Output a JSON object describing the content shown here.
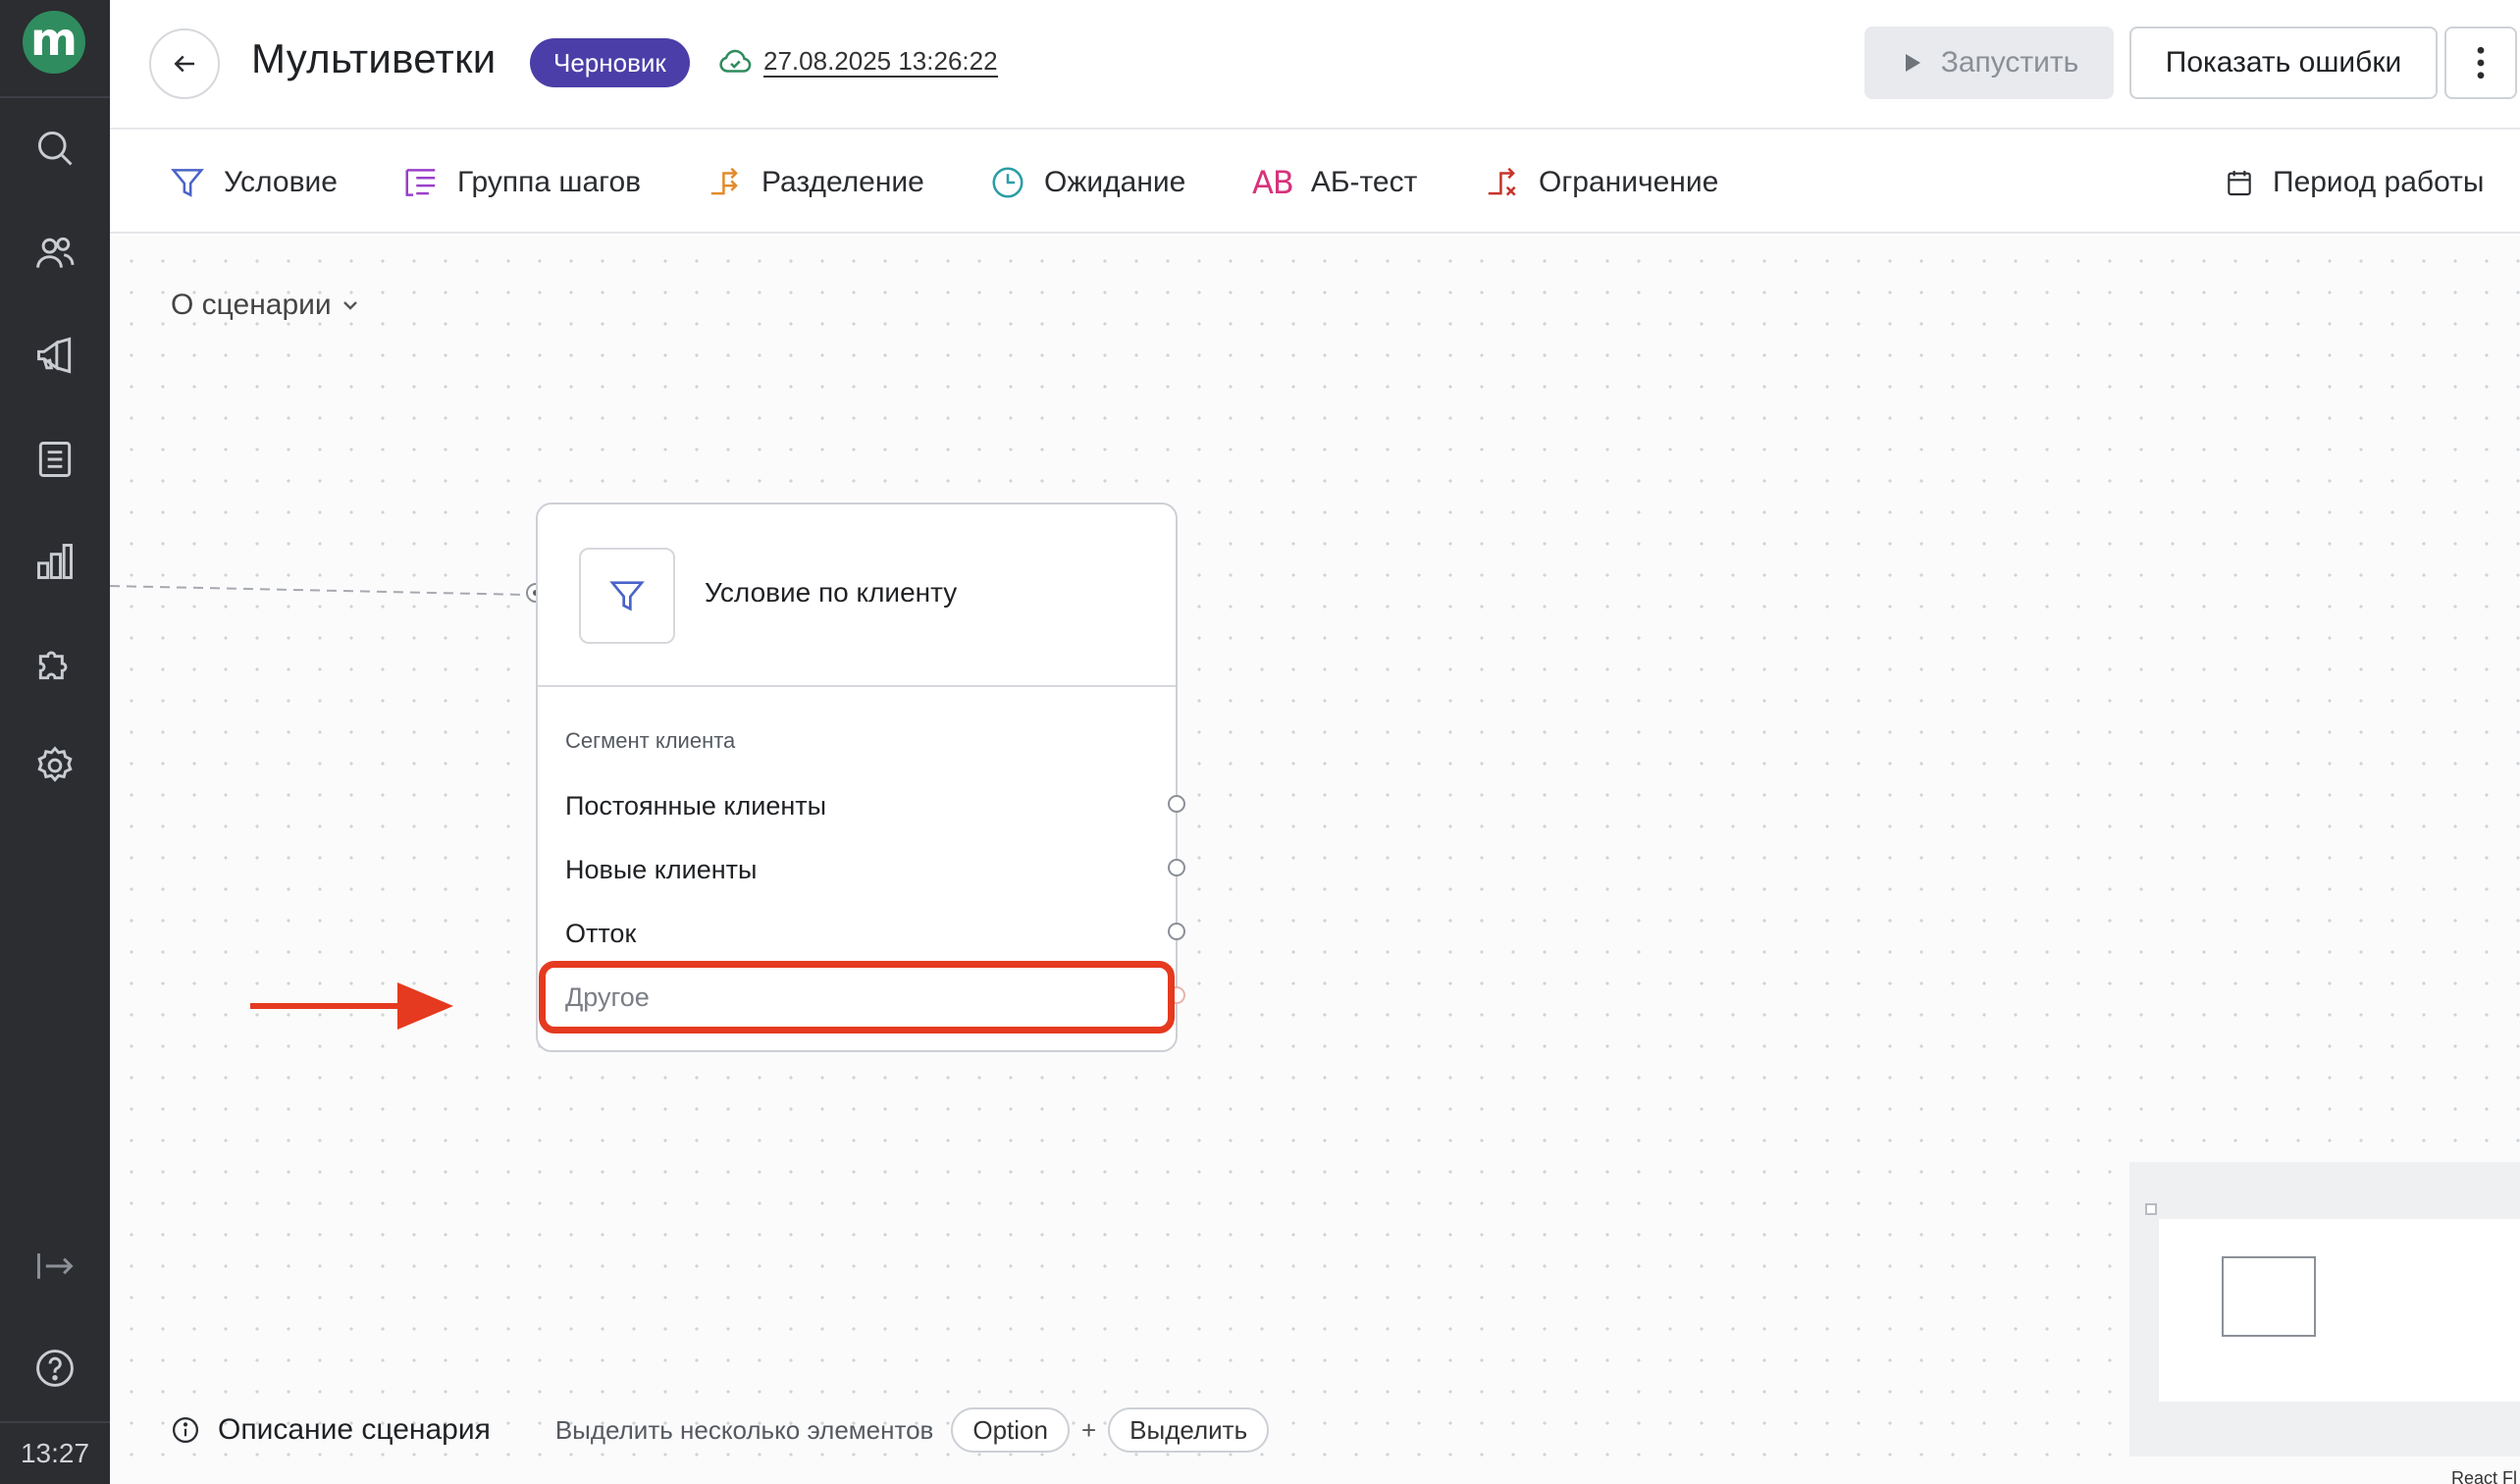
{
  "sidebar": {
    "logo_letter": "m",
    "time": "13:27",
    "items": [
      "search-icon",
      "users-icon",
      "campaigns-icon",
      "document-icon",
      "analytics-icon",
      "integrations-icon",
      "settings-icon",
      "collapse-icon",
      "help-icon"
    ]
  },
  "header": {
    "title": "Мультиветки",
    "status_badge": "Черновик",
    "saved_at": "27.08.2025 13:26:22",
    "run_label": "Запустить",
    "show_errors_label": "Показать ошибки"
  },
  "toolbar": {
    "items": [
      {
        "label": "Условие",
        "icon": "filter-icon"
      },
      {
        "label": "Группа шагов",
        "icon": "step-group-icon"
      },
      {
        "label": "Разделение",
        "icon": "split-icon"
      },
      {
        "label": "Ожидание",
        "icon": "clock-icon"
      },
      {
        "label": "АБ-тест",
        "icon_text": "AB"
      },
      {
        "label": "Ограничение",
        "icon": "limit-icon"
      }
    ],
    "schedule_label": "Период работы"
  },
  "canvas": {
    "about_label": "О сценарии",
    "node": {
      "title": "Условие по клиенту",
      "section_label": "Сегмент клиента",
      "branches": [
        "Постоянные клиенты",
        "Новые клиенты",
        "Отток",
        "Другое"
      ]
    },
    "footer": {
      "description_label": "Описание сценария",
      "multi_select_hint": "Выделить несколько элементов",
      "key_option": "Option",
      "plus": "+",
      "key_select": "Выделить"
    },
    "attribution": "React Fl"
  },
  "colors": {
    "sidebar_bg": "#2b2d31",
    "brand_green": "#2f8c5e",
    "badge_purple": "#4b3ea8",
    "highlight_red": "#e53a1f"
  }
}
